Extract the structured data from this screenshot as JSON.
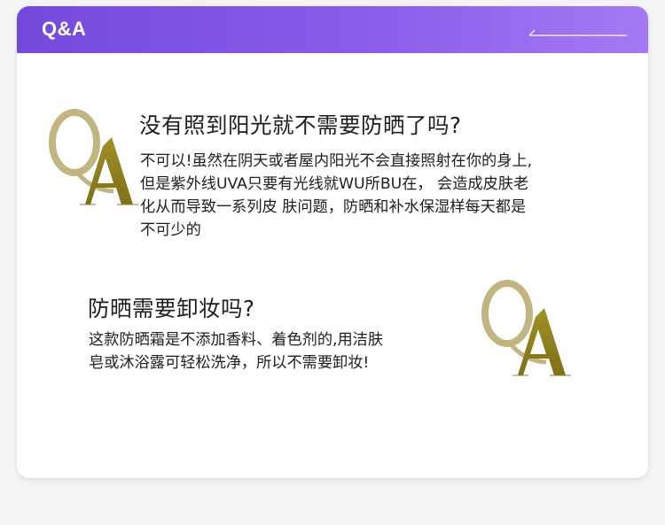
{
  "header": {
    "title": "Q&A"
  },
  "colors": {
    "header_start": "#7349dc",
    "header_end": "#a47af4",
    "gold_light": "#b8a870",
    "gold_dark": "#8a7d2a",
    "text": "#1e1e1e"
  },
  "qa": [
    {
      "question": "没有照到阳光就不需要防晒了吗?",
      "answer_lines": [
        "不可以!虽然在阴天或者屋内阳光不会直接照射在你的身上,",
        "但是紫外线UVA只要有光线就WU所BU在， 会造成皮肤老",
        "化从而导致一系列皮 肤问题，防晒和补水保湿样每天都是",
        "不可少的"
      ]
    },
    {
      "question": "防晒需要卸妆吗?",
      "answer_lines": [
        "这款防晒霜是不添加香料、着色剂的,用洁肤",
        "皂或沐浴露可轻松洗净，所以不需要卸妆!"
      ]
    }
  ]
}
